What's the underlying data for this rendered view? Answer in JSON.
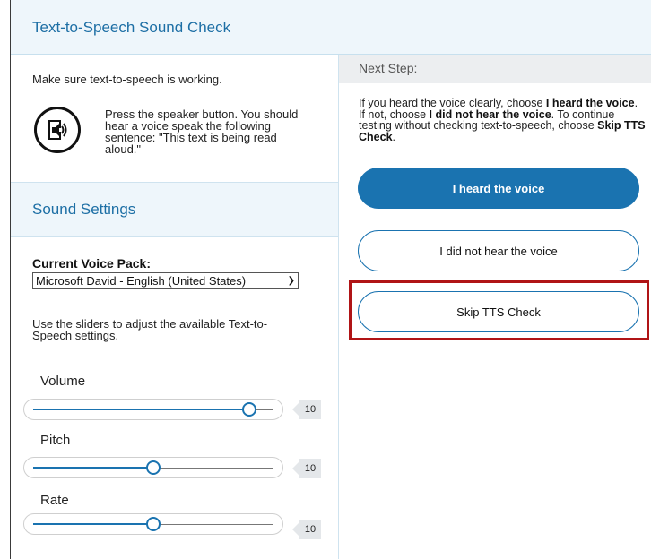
{
  "header": {
    "title": "Text-to-Speech Sound Check"
  },
  "left": {
    "intro": "Make sure text-to-speech is working.",
    "speaker_instructions": "Press the speaker button. You should hear a voice speak the following sentence: \"This text is being read aloud.\"",
    "sound_settings_title": "Sound Settings",
    "voice_pack_label": "Current Voice Pack:",
    "voice_pack_value": "Microsoft David - English (United States)",
    "sliders_hint": "Use the sliders to adjust the available Text-to-Speech settings.",
    "sliders": [
      {
        "label": "Volume",
        "value": "10",
        "level": 0.9
      },
      {
        "label": "Pitch",
        "value": "10",
        "level": 0.5
      },
      {
        "label": "Rate",
        "value": "10",
        "level": 0.5
      }
    ]
  },
  "right": {
    "next_step_title": "Next Step:",
    "instructions": {
      "p1": "If you heard the voice clearly, choose ",
      "b1": "I heard the voice",
      "p2": ". If not, choose ",
      "b2": "I did not hear the voice",
      "p3": ". To continue testing without checking text-to-speech, choose ",
      "b3": "Skip TTS Check",
      "p4": "."
    },
    "buttons": {
      "heard": "I heard the voice",
      "not_heard": "I did not hear the voice",
      "skip": "Skip TTS Check"
    }
  },
  "colors": {
    "accent": "#1a73b0",
    "header_bg": "#eef6fb",
    "highlight": "#b01416"
  },
  "icons": {
    "speaker": "speaker-icon"
  }
}
